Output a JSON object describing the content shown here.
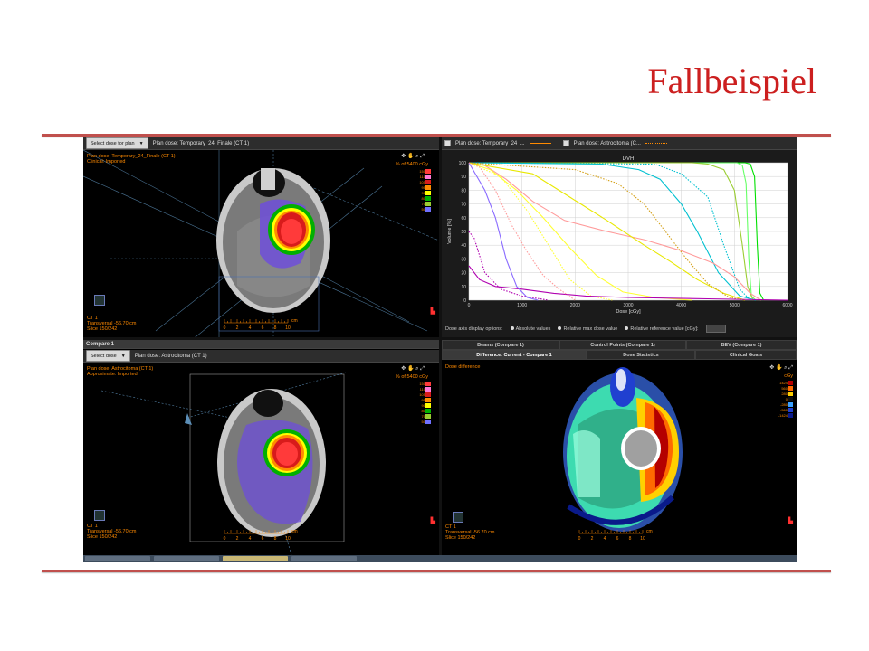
{
  "slide": {
    "title": "Fallbeispiel"
  },
  "top_left": {
    "select_button": "Select dose for plan",
    "plan_label": "Plan dose: Temporary_24_Finale (CT 1)",
    "overlay_line1": "Plan dose: Temporary_24_Finale (CT 1)",
    "overlay_line2": "Clinical: Imported",
    "scale_header": "% of 5400 cGy",
    "scale_values": [
      "150",
      "110",
      "105",
      "95",
      "90",
      "80",
      "70",
      "50"
    ],
    "ct_label": "CT 1",
    "view_label": "Transversal -56.70 cm",
    "slice_label": "Slice 150/242",
    "ruler_unit": "cm",
    "ruler_ticks": [
      "0",
      "2",
      "4",
      "6",
      "8",
      "10"
    ]
  },
  "dvh": {
    "legend1": "Plan dose: Temporary_24_...",
    "legend2": "Plan dose: Astrocitoma (C...",
    "title": "DVH",
    "xlabel": "Dose [cGy]",
    "ylabel": "Volume [%]",
    "options_label": "Dose axis display options:",
    "opt_abs": "Absolute values",
    "opt_rel_max": "Relative max dose value",
    "opt_rel_ref": "Relative reference value [cGy]:"
  },
  "chart_data": {
    "type": "line",
    "title": "DVH",
    "xlabel": "Dose [cGy]",
    "ylabel": "Volume [%]",
    "xlim": [
      0,
      6000
    ],
    "ylim": [
      0,
      100
    ],
    "x_ticks": [
      0,
      1000,
      2000,
      3000,
      4000,
      5000,
      6000
    ],
    "y_ticks": [
      0,
      10,
      20,
      30,
      40,
      50,
      60,
      70,
      80,
      90,
      100
    ],
    "series": [
      {
        "color": "#00e000",
        "style": "solid",
        "points": [
          [
            0,
            100
          ],
          [
            5200,
            100
          ],
          [
            5300,
            99
          ],
          [
            5380,
            90
          ],
          [
            5430,
            40
          ],
          [
            5480,
            5
          ],
          [
            5550,
            0
          ]
        ]
      },
      {
        "color": "#66ff66",
        "style": "solid",
        "points": [
          [
            0,
            100
          ],
          [
            5050,
            100
          ],
          [
            5150,
            98
          ],
          [
            5220,
            85
          ],
          [
            5270,
            30
          ],
          [
            5320,
            3
          ],
          [
            5400,
            0
          ]
        ]
      },
      {
        "color": "#9acd32",
        "style": "solid",
        "points": [
          [
            0,
            100
          ],
          [
            4200,
            100
          ],
          [
            4500,
            99
          ],
          [
            4800,
            95
          ],
          [
            5000,
            80
          ],
          [
            5150,
            40
          ],
          [
            5250,
            10
          ],
          [
            5350,
            0
          ]
        ]
      },
      {
        "color": "#00c0d0",
        "style": "solid",
        "points": [
          [
            0,
            100
          ],
          [
            2500,
            99
          ],
          [
            3200,
            95
          ],
          [
            3600,
            88
          ],
          [
            4000,
            70
          ],
          [
            4300,
            50
          ],
          [
            4700,
            20
          ],
          [
            5100,
            3
          ],
          [
            5400,
            0
          ]
        ]
      },
      {
        "color": "#00c0d0",
        "style": "dotted",
        "points": [
          [
            0,
            100
          ],
          [
            3500,
            99
          ],
          [
            4000,
            92
          ],
          [
            4500,
            75
          ],
          [
            4800,
            40
          ],
          [
            5100,
            8
          ],
          [
            5300,
            0
          ]
        ]
      },
      {
        "color": "#ff9a9a",
        "style": "solid",
        "points": [
          [
            0,
            100
          ],
          [
            300,
            98
          ],
          [
            700,
            88
          ],
          [
            1200,
            72
          ],
          [
            1800,
            58
          ],
          [
            2600,
            50
          ],
          [
            3300,
            44
          ],
          [
            4000,
            36
          ],
          [
            4600,
            27
          ],
          [
            5000,
            17
          ],
          [
            5300,
            5
          ],
          [
            5500,
            0
          ]
        ]
      },
      {
        "color": "#ffff33",
        "style": "solid",
        "points": [
          [
            0,
            100
          ],
          [
            400,
            95
          ],
          [
            900,
            80
          ],
          [
            1400,
            60
          ],
          [
            1900,
            38
          ],
          [
            2400,
            18
          ],
          [
            2900,
            6
          ],
          [
            3500,
            2
          ],
          [
            4200,
            0
          ]
        ]
      },
      {
        "color": "#ffff33",
        "style": "dotted",
        "points": [
          [
            0,
            100
          ],
          [
            600,
            90
          ],
          [
            1100,
            65
          ],
          [
            1500,
            40
          ],
          [
            1900,
            15
          ],
          [
            2300,
            3
          ],
          [
            2700,
            0
          ]
        ]
      },
      {
        "color": "#e8e800",
        "style": "solid",
        "points": [
          [
            0,
            100
          ],
          [
            1200,
            92
          ],
          [
            1900,
            75
          ],
          [
            2600,
            58
          ],
          [
            3300,
            40
          ],
          [
            3800,
            28
          ],
          [
            4300,
            15
          ],
          [
            4800,
            5
          ],
          [
            5200,
            0
          ]
        ]
      },
      {
        "color": "#d4a017",
        "style": "dotted",
        "points": [
          [
            0,
            100
          ],
          [
            2000,
            95
          ],
          [
            2800,
            85
          ],
          [
            3300,
            70
          ],
          [
            3700,
            50
          ],
          [
            4100,
            30
          ],
          [
            4500,
            12
          ],
          [
            4900,
            2
          ],
          [
            5200,
            0
          ]
        ]
      },
      {
        "color": "#b000b0",
        "style": "solid",
        "points": [
          [
            0,
            25
          ],
          [
            200,
            15
          ],
          [
            500,
            10
          ],
          [
            1000,
            8
          ],
          [
            1600,
            5
          ],
          [
            2200,
            3
          ],
          [
            3000,
            2
          ],
          [
            4500,
            1
          ],
          [
            6000,
            0
          ]
        ]
      },
      {
        "color": "#8a6bff",
        "style": "solid",
        "points": [
          [
            0,
            100
          ],
          [
            300,
            80
          ],
          [
            500,
            60
          ],
          [
            700,
            30
          ],
          [
            900,
            10
          ],
          [
            1100,
            2
          ],
          [
            1300,
            0
          ]
        ]
      },
      {
        "color": "#b000b0",
        "style": "dotted",
        "points": [
          [
            0,
            50
          ],
          [
            100,
            45
          ],
          [
            300,
            20
          ],
          [
            600,
            8
          ],
          [
            1000,
            3
          ],
          [
            1500,
            0
          ]
        ]
      },
      {
        "color": "#ff9a9a",
        "style": "dotted",
        "points": [
          [
            0,
            100
          ],
          [
            200,
            97
          ],
          [
            500,
            80
          ],
          [
            800,
            55
          ],
          [
            1100,
            35
          ],
          [
            1400,
            18
          ],
          [
            1700,
            8
          ],
          [
            2000,
            0
          ]
        ]
      }
    ]
  },
  "bottom_left": {
    "compare_tab": "Compare 1",
    "select_button": "Select dose",
    "plan_label": "Plan dose: Astrocitoma (CT 1)",
    "overlay_line1": "Plan dose: Astrocitoma (CT 1)",
    "overlay_line2": "Approximate: Imported",
    "scale_header": "% of 5400 cGy",
    "scale_values": [
      "150",
      "110",
      "105",
      "95",
      "90",
      "80",
      "70",
      "50"
    ],
    "ct_label": "CT 1",
    "view_label": "Transversal -56.70 cm",
    "slice_label": "Slice 150/242",
    "ruler_unit": "cm",
    "ruler_ticks": [
      "0",
      "2",
      "4",
      "6",
      "8",
      "10"
    ]
  },
  "bottom_right": {
    "tabs_row1": [
      "Beams (Compare 1)",
      "Control Points (Compare 1)",
      "BEV (Compare 1)"
    ],
    "tabs_row2": [
      "Difference: Current - Compare 1",
      "Dose Statistics",
      "Clinical Goals"
    ],
    "overlay_title": "Dose difference",
    "scale_header": "cGy",
    "scale_values": [
      "1424",
      "560",
      "280",
      "0",
      "-280",
      "-560",
      "-1424"
    ],
    "ct_label": "CT 1",
    "view_label": "Transversal -56.70 cm",
    "slice_label": "Slice 150/242",
    "ruler_unit": "cm",
    "ruler_ticks": [
      "0",
      "2",
      "4",
      "6",
      "8",
      "10"
    ]
  },
  "colors": {
    "title_red": "#cc1f1f",
    "rule_red": "#c0504d",
    "overlay_orange": "#ff8a00",
    "scale_colors": [
      "#ff3a3a",
      "#ff7ad9",
      "#d81b1b",
      "#ff8c00",
      "#ffff00",
      "#00b000",
      "#9acd32",
      "#7070ff"
    ],
    "diff_scale_colors": [
      "#b40000",
      "#ff6a00",
      "#ffd000",
      "#111111",
      "#3aa0ff",
      "#2040d0",
      "#0a1a8a"
    ]
  }
}
